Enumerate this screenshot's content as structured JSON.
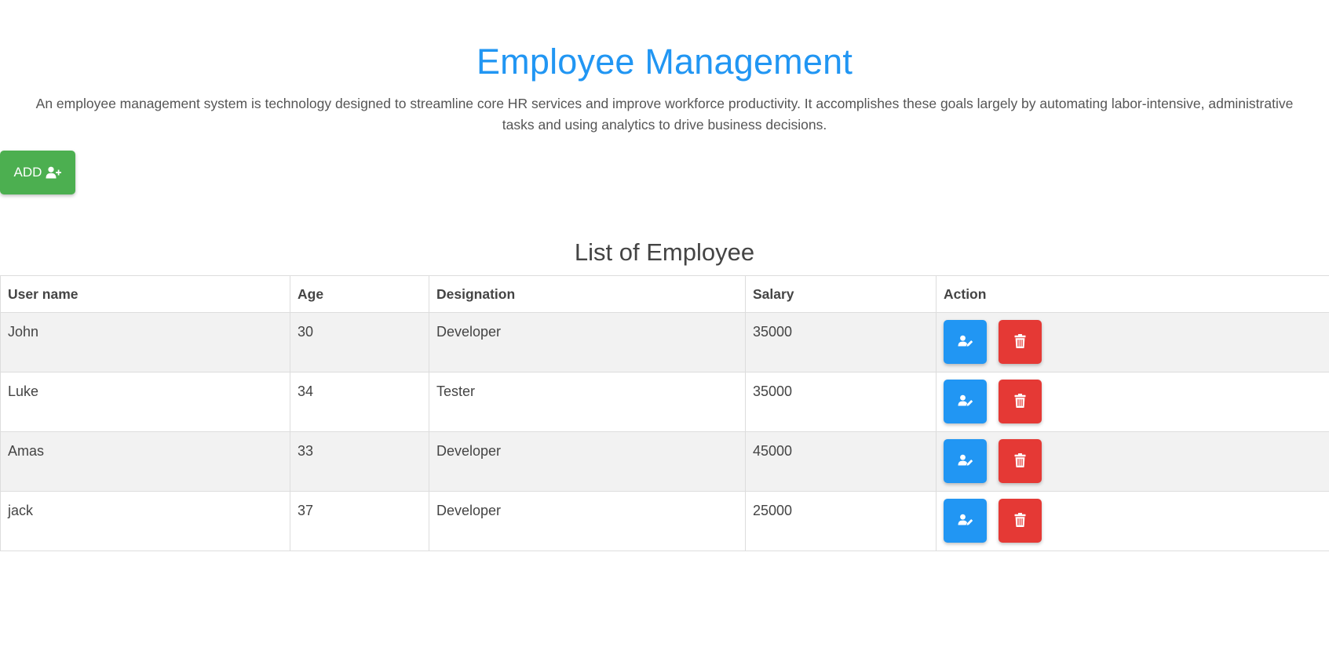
{
  "header": {
    "title": "Employee Management",
    "description": "An employee management system is technology designed to streamline core HR services and improve workforce productivity. It accomplishes these goals largely by automating labor-intensive, administrative tasks and using analytics to drive business decisions."
  },
  "toolbar": {
    "add_label": "ADD",
    "add_icon": "user-plus-icon"
  },
  "employees": {
    "title": "List of Employee",
    "columns": [
      "User name",
      "Age",
      "Designation",
      "Salary",
      "Action"
    ],
    "rows": [
      {
        "name": "John",
        "age": "30",
        "designation": "Developer",
        "salary": "35000"
      },
      {
        "name": "Luke",
        "age": "34",
        "designation": "Tester",
        "salary": "35000"
      },
      {
        "name": "Amas",
        "age": "33",
        "designation": "Developer",
        "salary": "45000"
      },
      {
        "name": "jack",
        "age": "37",
        "designation": "Developer",
        "salary": "25000"
      }
    ],
    "actions": {
      "edit_icon": "user-edit-icon",
      "delete_icon": "trash-icon"
    }
  },
  "colors": {
    "title": "#2196f3",
    "add_button": "#4caf50",
    "edit_button": "#2196f3",
    "delete_button": "#e53935",
    "row_stripe": "#f2f2f2"
  }
}
